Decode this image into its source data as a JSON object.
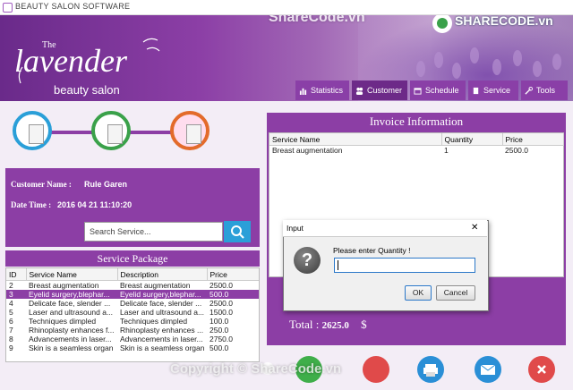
{
  "window": {
    "title": "BEAUTY SALON SOFTWARE"
  },
  "logo": {
    "the": "The",
    "main": "lavender",
    "sub": "beauty salon"
  },
  "watermark": {
    "top": "ShareCode.vn",
    "brand": "SHARECODE.vn",
    "bottom": "Copyright © ShareCode.vn"
  },
  "nav": [
    {
      "label": "Statistics",
      "icon": "bar-chart-icon"
    },
    {
      "label": "Customer",
      "icon": "users-icon"
    },
    {
      "label": "Schedule",
      "icon": "calendar-icon"
    },
    {
      "label": "Service",
      "icon": "book-icon"
    },
    {
      "label": "Tools",
      "icon": "wrench-icon"
    }
  ],
  "customer": {
    "name_label": "Customer Name :",
    "name_value": "Rule Garen",
    "datetime_label": "Date Time :",
    "datetime_value": "2016 04 21 11:10:20"
  },
  "search": {
    "placeholder": "Search Service..."
  },
  "service_package": {
    "title": "Service Package",
    "columns": [
      "ID",
      "Service Name",
      "Description",
      "Price"
    ],
    "rows": [
      [
        "2",
        "Breast augmentation",
        "Breast augmentation",
        "2500.0"
      ],
      [
        "3",
        "Eyelid surgery,blephar...",
        "Eyelid surgery,blephar...",
        "500.0"
      ],
      [
        "4",
        "Delicate face, slender ...",
        "Delicate face, slender ...",
        "2500.0"
      ],
      [
        "5",
        "Laser and ultrasound a...",
        "Laser and ultrasound a...",
        "1500.0"
      ],
      [
        "6",
        "Techniques dimpled",
        "Techniques dimpled",
        "100.0"
      ],
      [
        "7",
        "Rhinoplasty enhances f...",
        "Rhinoplasty enhances ...",
        "250.0"
      ],
      [
        "8",
        "Advancements in laser...",
        "Advancements in laser...",
        "2750.0"
      ],
      [
        "9",
        "Skin is a seamless organ",
        "Skin is a seamless organ",
        "500.0"
      ]
    ],
    "selected_index": 1
  },
  "invoice": {
    "title": "Invoice Information",
    "columns": [
      "Service Name",
      "Quantity",
      "Price"
    ],
    "rows": [
      [
        "Breast augmentation",
        "1",
        "2500.0"
      ]
    ],
    "total_label": "Total :",
    "total_value": "2625.0",
    "currency": "$"
  },
  "dialog": {
    "title": "Input",
    "message": "Please enter Quantity !",
    "value": "",
    "ok": "OK",
    "cancel": "Cancel",
    "close": "✕"
  },
  "colors": {
    "accent": "#8c3ea5",
    "search_blue": "#2a9fd8"
  },
  "action_buttons": [
    {
      "name": "add",
      "color": "#3fae4a"
    },
    {
      "name": "delete",
      "color": "#e04a4a"
    },
    {
      "name": "print",
      "color": "#2a8fd6"
    },
    {
      "name": "email",
      "color": "#2a8fd6"
    },
    {
      "name": "close",
      "color": "#e04a4a"
    }
  ]
}
